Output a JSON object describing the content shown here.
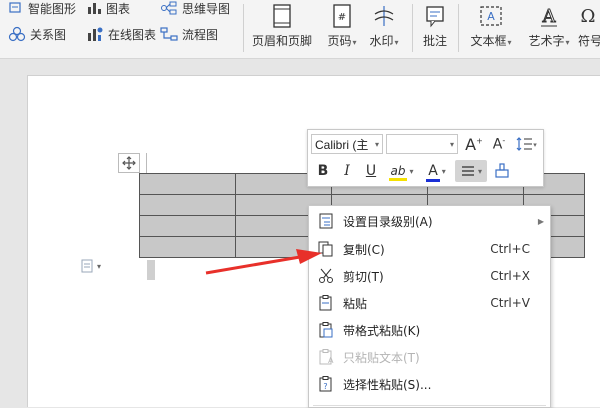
{
  "ribbon": {
    "row1": [
      {
        "label": "智能图形",
        "icon": "smart-graphic-icon"
      },
      {
        "label": "图表",
        "icon": "chart-icon"
      },
      {
        "label": "思维导图",
        "icon": "mindmap-icon"
      }
    ],
    "row2": [
      {
        "label": "关系图",
        "icon": "relation-icon"
      },
      {
        "label": "在线图表",
        "icon": "online-chart-icon"
      },
      {
        "label": "流程图",
        "icon": "flowchart-icon"
      }
    ],
    "big": [
      {
        "label": "页眉和页脚",
        "icon": "header-footer-icon"
      },
      {
        "label": "页码",
        "icon": "page-number-icon"
      },
      {
        "label": "水印",
        "icon": "watermark-icon"
      },
      {
        "label": "批注",
        "icon": "comment-icon"
      },
      {
        "label": "文本框",
        "icon": "textbox-icon"
      },
      {
        "label": "艺术字",
        "icon": "wordart-icon"
      },
      {
        "label": "符号",
        "icon": "symbol-icon"
      }
    ]
  },
  "mini_toolbar": {
    "font_name": "Calibri (主",
    "font_size": "",
    "grow_font": "A",
    "shrink_font": "A",
    "bold": "B",
    "italic": "I",
    "underline": "U",
    "highlight": "ab",
    "font_color": "A",
    "highlight_color": "#f5e100",
    "font_color_value": "#1a2fd6"
  },
  "context_menu": {
    "items": [
      {
        "label": "设置目录级别(A)",
        "shortcut": "",
        "submenu": true,
        "disabled": false,
        "icon": "toc-level-icon"
      },
      {
        "label": "复制(C)",
        "shortcut": "Ctrl+C",
        "submenu": false,
        "disabled": false,
        "icon": "copy-icon"
      },
      {
        "label": "剪切(T)",
        "shortcut": "Ctrl+X",
        "submenu": false,
        "disabled": false,
        "icon": "cut-icon"
      },
      {
        "label": "粘贴",
        "shortcut": "Ctrl+V",
        "submenu": false,
        "disabled": false,
        "icon": "paste-icon"
      },
      {
        "label": "带格式粘贴(K)",
        "shortcut": "",
        "submenu": false,
        "disabled": false,
        "icon": "paste-format-icon"
      },
      {
        "label": "只粘贴文本(T)",
        "shortcut": "",
        "submenu": false,
        "disabled": true,
        "icon": "paste-text-icon"
      },
      {
        "label": "选择性粘贴(S)...",
        "shortcut": "",
        "submenu": false,
        "disabled": false,
        "icon": "paste-special-icon"
      }
    ]
  },
  "colors": {
    "annotation_arrow": "#e8302a",
    "table_fill": "#c8c8c8"
  }
}
